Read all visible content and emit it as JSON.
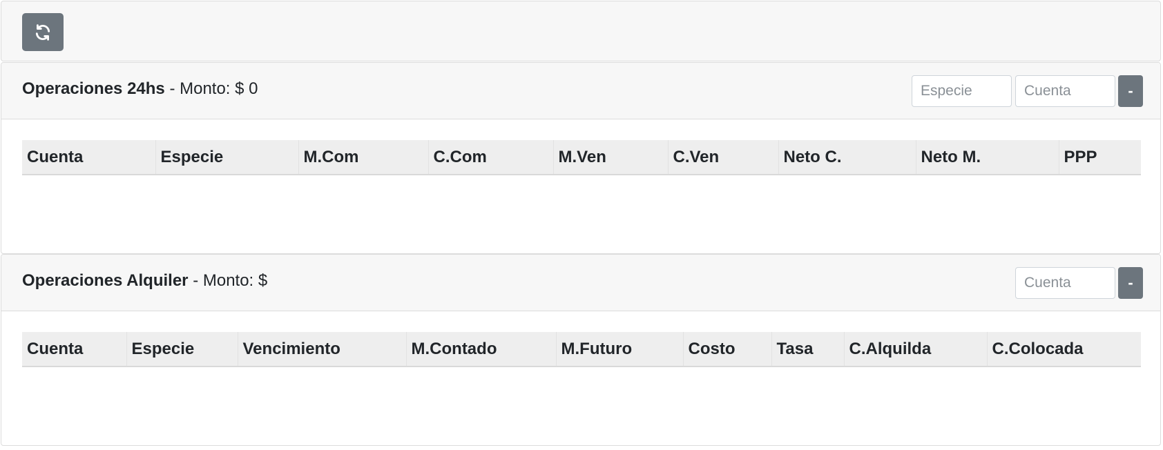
{
  "toolbar": {
    "refresh_icon": "refresh-icon"
  },
  "panel_24hs": {
    "title": "Operaciones 24hs",
    "monto_label": "- Monto: $ 0",
    "especie_placeholder": "Especie",
    "cuenta_placeholder": "Cuenta",
    "collapse_label": "-",
    "columns": [
      "Cuenta",
      "Especie",
      "M.Com",
      "C.Com",
      "M.Ven",
      "C.Ven",
      "Neto C.",
      "Neto M.",
      "PPP"
    ]
  },
  "panel_alquiler": {
    "title": "Operaciones Alquiler",
    "monto_label": "- Monto: $",
    "cuenta_placeholder": "Cuenta",
    "collapse_label": "-",
    "columns": [
      "Cuenta",
      "Especie",
      "Vencimiento",
      "M.Contado",
      "M.Futuro",
      "Costo",
      "Tasa",
      "C.Alquilda",
      "C.Colocada"
    ]
  },
  "colors": {
    "button_gray": "#6c757d",
    "header_bg": "#f7f7f7",
    "table_head_bg": "#eeeeee"
  }
}
